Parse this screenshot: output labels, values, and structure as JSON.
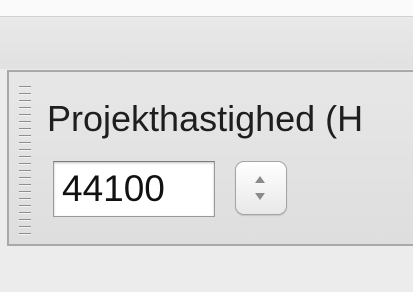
{
  "project_rate": {
    "label": "Projekthastighed (H",
    "value": "44100"
  },
  "stepper": {
    "up_icon": "arrow-up-icon",
    "down_icon": "arrow-down-icon"
  },
  "colors": {
    "background": "#ececec",
    "panel_border": "#a9a9a9",
    "text": "#1e1e1e"
  }
}
